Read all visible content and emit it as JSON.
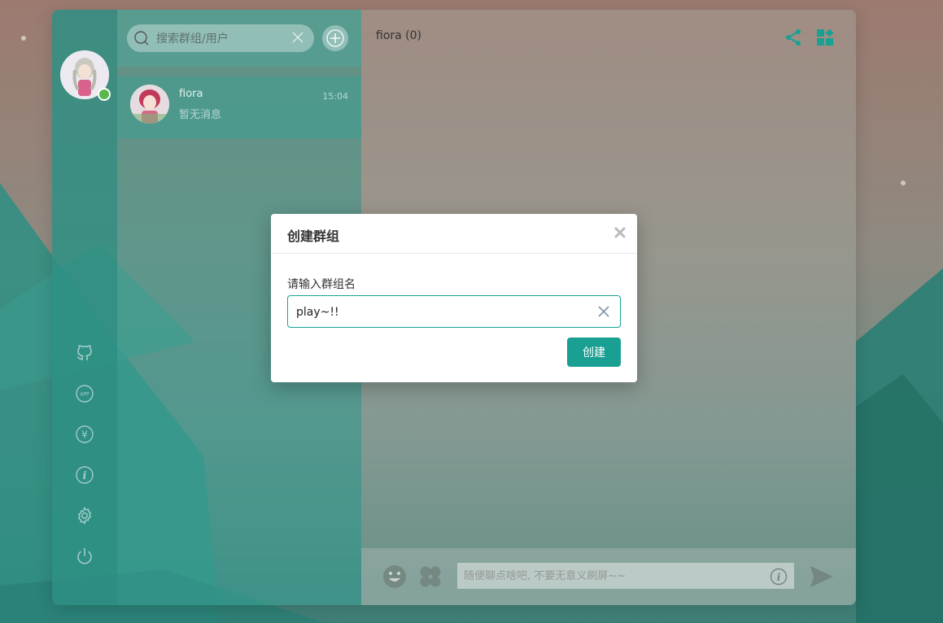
{
  "sidebar": {
    "user_online": true,
    "nav_icons": [
      "github-icon",
      "app-icon",
      "yuan-icon",
      "info-icon",
      "settings-icon",
      "power-icon"
    ]
  },
  "conversation_list": {
    "search_placeholder": "搜索群组/用户",
    "items": [
      {
        "name": "fiora",
        "time": "15:04",
        "preview": "暂无消息"
      }
    ]
  },
  "main": {
    "header_title": "fiora (0)",
    "composer_placeholder": "随便聊点啥吧, 不要无意义刷屏~~"
  },
  "dialog": {
    "title": "创建群组",
    "label": "请输入群组名",
    "input_value": "play~!!",
    "submit_label": "创建"
  },
  "colors": {
    "accent": "#1a9f93",
    "online": "#58b84a"
  }
}
